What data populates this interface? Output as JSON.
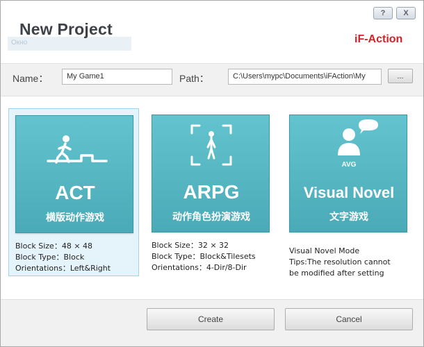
{
  "window": {
    "title": "New Project",
    "help_label": "?",
    "close_label": "X",
    "ghost_label": "Окно"
  },
  "logo": {
    "text": "iF-Action",
    "color": "#d62027"
  },
  "form": {
    "name_label": "Name：",
    "name_value": "My Game1",
    "path_label": "Path：",
    "path_value": "C:\\Users\\mypc\\Documents\\iFAction\\My",
    "browse_label": "..."
  },
  "cards": [
    {
      "id": "act",
      "selected": true,
      "icon": "running-stickman-stairs-icon",
      "title": "ACT",
      "subtitle": "横版动作游戏",
      "info": [
        "Block Size：48 × 48",
        "Block Type：Block",
        "Orientations：Left&Right"
      ]
    },
    {
      "id": "arpg",
      "selected": false,
      "icon": "framed-figure-icon",
      "title": "ARPG",
      "subtitle": "动作角色扮演游戏",
      "info": [
        "Block Size：32 × 32",
        "Block Type：Block&Tilesets",
        "Orientations：4-Dir/8-Dir"
      ]
    },
    {
      "id": "vn",
      "selected": false,
      "icon": "avatar-speech-bubble-icon",
      "icon_label": "AVG",
      "title": "Visual Novel",
      "subtitle": "文字游戏",
      "info": [
        "Visual Novel Mode",
        "Tips:The resolution cannot",
        "be modified after setting"
      ]
    }
  ],
  "footer": {
    "create_label": "Create",
    "cancel_label": "Cancel"
  },
  "colors": {
    "tile": "#56b6c2",
    "selected_bg": "#e5f3fb",
    "selected_border": "#9fd4ef"
  }
}
